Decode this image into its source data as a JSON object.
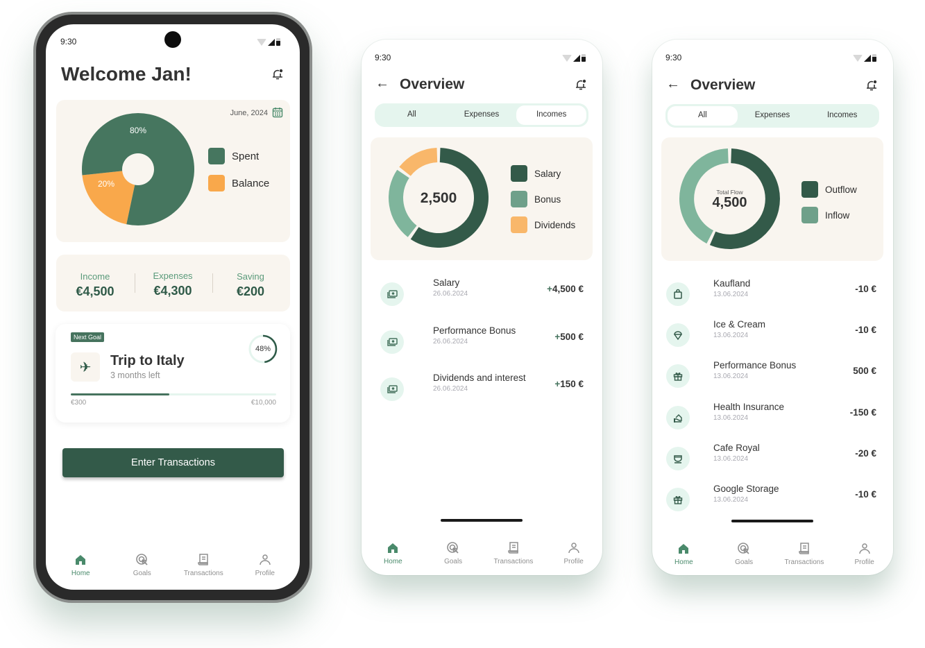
{
  "status_time": "9:30",
  "home": {
    "title": "Welcome Jan!",
    "date": "June, 2024",
    "chart_data": {
      "type": "pie",
      "series": [
        {
          "name": "Spent",
          "value": 80,
          "label": "80%",
          "color": "#46765f"
        },
        {
          "name": "Balance",
          "value": 20,
          "label": "20%",
          "color": "#f9a84b"
        }
      ]
    },
    "stats": [
      {
        "label": "Income",
        "value": "€4,500"
      },
      {
        "label": "Expenses",
        "value": "€4,300"
      },
      {
        "label": "Saving",
        "value": "€200"
      }
    ],
    "goal": {
      "badge": "Next Goal",
      "title": "Trip to Italy",
      "subtitle": "3 months left",
      "percent_label": "48%",
      "percent": 48,
      "min": "€300",
      "max": "€10,000"
    },
    "cta": "Enter Transactions"
  },
  "nav": [
    {
      "label": "Home",
      "icon": "home-icon"
    },
    {
      "label": "Goals",
      "icon": "goals-icon"
    },
    {
      "label": "Transactions",
      "icon": "receipt-icon"
    },
    {
      "label": "Profile",
      "icon": "profile-icon"
    }
  ],
  "incomes": {
    "title": "Overview",
    "tabs": [
      "All",
      "Expenses",
      "Incomes"
    ],
    "active_tab": 2,
    "center": "2,500",
    "chart_data": {
      "type": "pie",
      "series": [
        {
          "name": "Salary",
          "value": 60,
          "color": "#335a49"
        },
        {
          "name": "Bonus",
          "value": 25,
          "color": "#7fb59c"
        },
        {
          "name": "Dividends",
          "value": 15,
          "color": "#f9b76a"
        }
      ]
    },
    "transactions": [
      {
        "name": "Salary",
        "date": "26.06.2024",
        "amount": "+4,500 €",
        "icon": "money-icon"
      },
      {
        "name": "Performance Bonus",
        "date": "26.06.2024",
        "amount": "+500 €",
        "icon": "money-icon"
      },
      {
        "name": "Dividends and interest",
        "date": "26.06.2024",
        "amount": "+150 €",
        "icon": "money-icon"
      }
    ]
  },
  "all": {
    "title": "Overview",
    "tabs": [
      "All",
      "Expenses",
      "Incomes"
    ],
    "active_tab": 0,
    "center_label": "Total Flow",
    "center": "4,500",
    "chart_data": {
      "type": "pie",
      "series": [
        {
          "name": "Outflow",
          "value": 57,
          "color": "#335a49"
        },
        {
          "name": "Inflow",
          "value": 43,
          "color": "#7fb59c"
        }
      ]
    },
    "transactions": [
      {
        "name": "Kaufland",
        "date": "13.06.2024",
        "amount": "-10 €",
        "icon": "shopping-bag-icon"
      },
      {
        "name": "Ice & Cream",
        "date": "13.06.2024",
        "amount": "-10 €",
        "icon": "ice-cream-icon"
      },
      {
        "name": "Performance Bonus",
        "date": "13.06.2024",
        "amount": "500 €",
        "icon": "gift-icon"
      },
      {
        "name": "Health Insurance",
        "date": "13.06.2024",
        "amount": "-150 €",
        "icon": "insurance-icon"
      },
      {
        "name": "Cafe Royal",
        "date": "13.06.2024",
        "amount": "-20 €",
        "icon": "coffee-icon"
      },
      {
        "name": "Google Storage",
        "date": "13.06.2024",
        "amount": "-10 €",
        "icon": "gift-icon"
      }
    ]
  }
}
